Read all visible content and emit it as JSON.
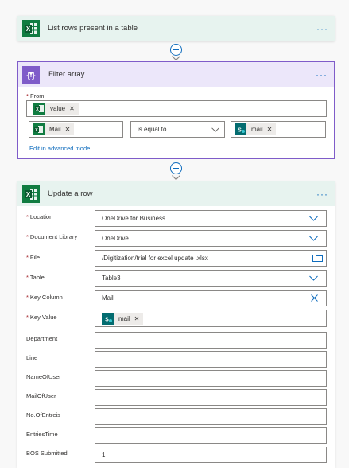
{
  "colors": {
    "excel_header": "#e7f3ef",
    "excel_green": "#107c41",
    "filter_header": "#ece7fa",
    "filter_accent": "#7f5cc9",
    "sharepoint_teal": "#036c70",
    "link_blue": "#0f6cbd",
    "required_red": "#a4262c"
  },
  "list_rows_card": {
    "title": "List rows present in a table",
    "icon": "excel-icon",
    "more_label": "···"
  },
  "filter_array_card": {
    "title": "Filter array",
    "icon": "filter-curly-braces-icon",
    "more_label": "···",
    "from_label": "From",
    "from_token": "value",
    "condition": {
      "left_token": "Mail",
      "operator": "is equal to",
      "right_token": "mail"
    },
    "advanced_link": "Edit in advanced mode"
  },
  "update_row_card": {
    "title": "Update a row",
    "icon": "excel-icon",
    "more_label": "···",
    "fields": {
      "location": {
        "label": "Location",
        "value": "OneDrive for Business"
      },
      "document_library": {
        "label": "Document Library",
        "value": "OneDrive"
      },
      "file": {
        "label": "File",
        "value": "/Digitization/trial for excel update .xlsx"
      },
      "table": {
        "label": "Table",
        "value": "Table3"
      },
      "key_column": {
        "label": "Key Column",
        "value": "Mail"
      },
      "key_value": {
        "label": "Key Value",
        "token": "mail"
      },
      "department": {
        "label": "Department",
        "value": ""
      },
      "line": {
        "label": "Line",
        "value": ""
      },
      "name_of_user": {
        "label": "NameOfUser",
        "value": ""
      },
      "mail_of_user": {
        "label": "MailOfUser",
        "value": ""
      },
      "no_of_entreis": {
        "label": "No.OfEntreis",
        "value": ""
      },
      "entries_time": {
        "label": "EntriesTime",
        "value": ""
      },
      "bos_submitted": {
        "label": "BOS Submitted",
        "value": "1"
      }
    }
  }
}
